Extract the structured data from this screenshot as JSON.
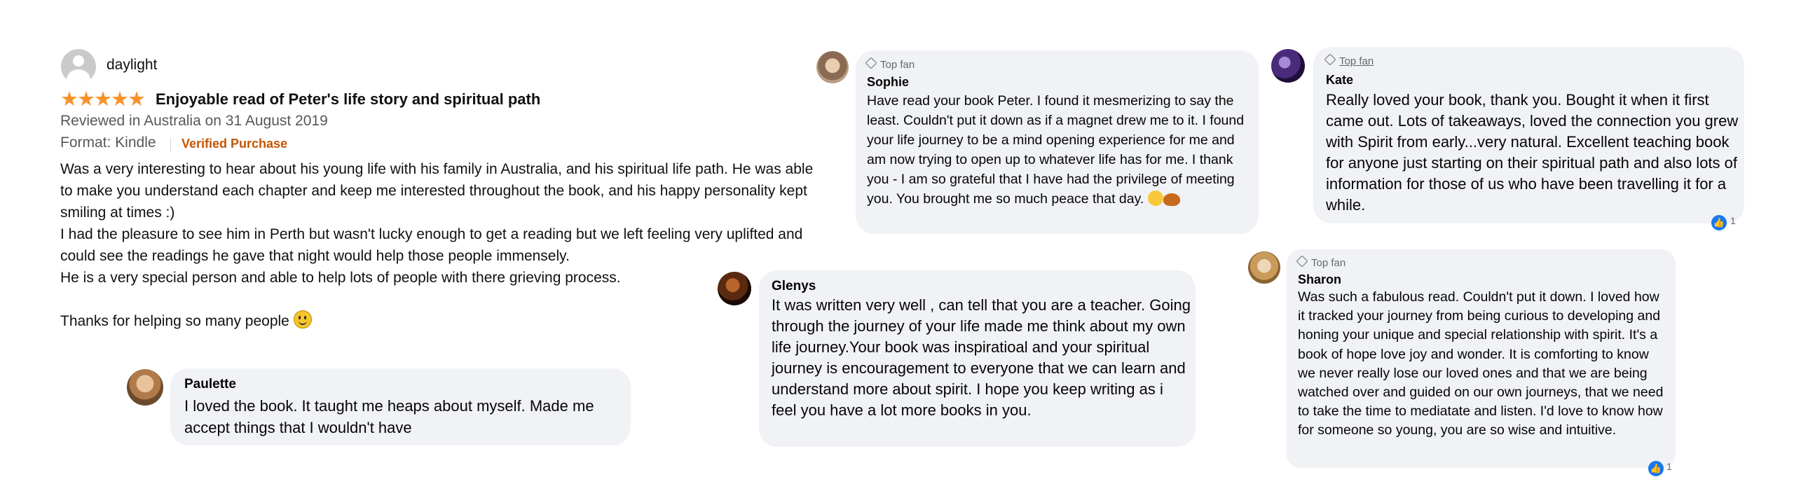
{
  "amazon_review": {
    "reviewer": "daylight",
    "stars": "★★★★★",
    "title": "Enjoyable read of Peter's life story and spiritual path",
    "meta": "Reviewed in Australia on 31 August 2019",
    "format": "Format: Kindle",
    "verified": "Verified Purchase",
    "paragraphs": [
      "Was a very interesting to hear about his young life with his family in Australia, and his spiritual life path. He was able to make you understand each chapter and keep me interested throughout the book, and his happy personality kept smiling at times :)",
      "I had the pleasure to see him in Perth but wasn't lucky enough to get a reading but we left feeling very uplifted and could see the readings he gave that night would help those people immensely.",
      "He is a very special person and able to help lots of people with there grieving process.",
      "Thanks for helping so many people"
    ]
  },
  "comments": {
    "paulette": {
      "name": "Paulette",
      "text": "I loved the book. It taught me heaps about myself. Made me accept things that I wouldn't have"
    },
    "sophie": {
      "badge": "Top fan",
      "name": "Sophie",
      "text": "Have read your book Peter. I found it mesmerizing to say the least. Couldn't put it down as if a magnet drew me to it. I found your life journey to be a mind opening experience for me and am now trying to open up to whatever life has for me. I thank you - I am so grateful that I have had the privilege of meeting you. You brought me so much peace that day."
    },
    "glenys": {
      "name": "Glenys",
      "text": "It was written very well , can tell that you are a teacher. Going through the journey of your life made me think about my own life journey.Your book was inspiratioal and your spiritual journey is encouragement to everyone that we can learn and understand more about spirit. I hope you keep writing as i feel you have a lot more books in you."
    },
    "kate": {
      "badge": "Top fan",
      "name": "Kate",
      "text": "Really loved your book, thank you. Bought it when it first came out. Lots of takeaways, loved the connection you grew with Spirit from early...very natural. Excellent teaching book for anyone just starting on their spiritual path and also lots of information for those of us who have been travelling it for a while.",
      "reaction_count": "1"
    },
    "sharon": {
      "badge": "Top fan",
      "name": "Sharon",
      "text": "Was such a fabulous read. Couldn't put it down. I loved how it tracked your journey from being curious to developing and honing your unique and special relationship with spirit. It's a book of hope love joy and wonder. It is comforting to know we never really lose our loved ones and that we are being watched over and guided on our own journeys, that we need to take the time to mediatate and listen. I'd love to know how for someone so young, you are so wise and intuitive.",
      "reaction_count": "1"
    }
  },
  "colors": {
    "star": "#f7922a",
    "verified": "#c45500",
    "bubble": "#f0f2f5",
    "like": "#1877f2"
  },
  "icons": [
    "reviewer-avatar",
    "diamond-badge-icon",
    "like-reaction-icon",
    "smiley-emoji",
    "hug-emoji",
    "butterfly-emoji"
  ]
}
